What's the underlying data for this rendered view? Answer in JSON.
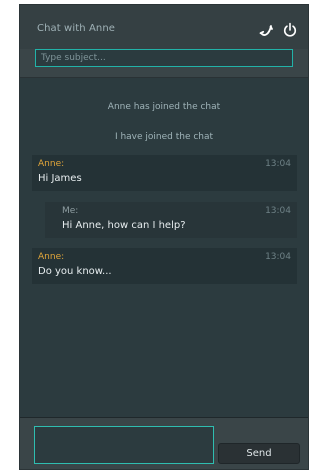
{
  "header": {
    "title": "Chat with Anne",
    "icons": [
      "phone-icon",
      "power-icon"
    ]
  },
  "subject": {
    "placeholder": "Type subject...",
    "value": ""
  },
  "system_messages": [
    "Anne has joined the chat",
    "I have joined the chat"
  ],
  "messages": [
    {
      "sender": "Anne:",
      "time": "13:04",
      "text": "Hi James"
    },
    {
      "sender": "Me:",
      "time": "13:04",
      "text": "Hi Anne, how can I help?"
    },
    {
      "sender": "Anne:",
      "time": "13:04",
      "text": "Do you know..."
    }
  ],
  "composer": {
    "value": ""
  },
  "send_label": "Send",
  "colors": {
    "accent": "#22b2a8",
    "anne_name": "#e0a53a",
    "panel": "#3a4548",
    "messages_bg": "#2c3b3f"
  }
}
